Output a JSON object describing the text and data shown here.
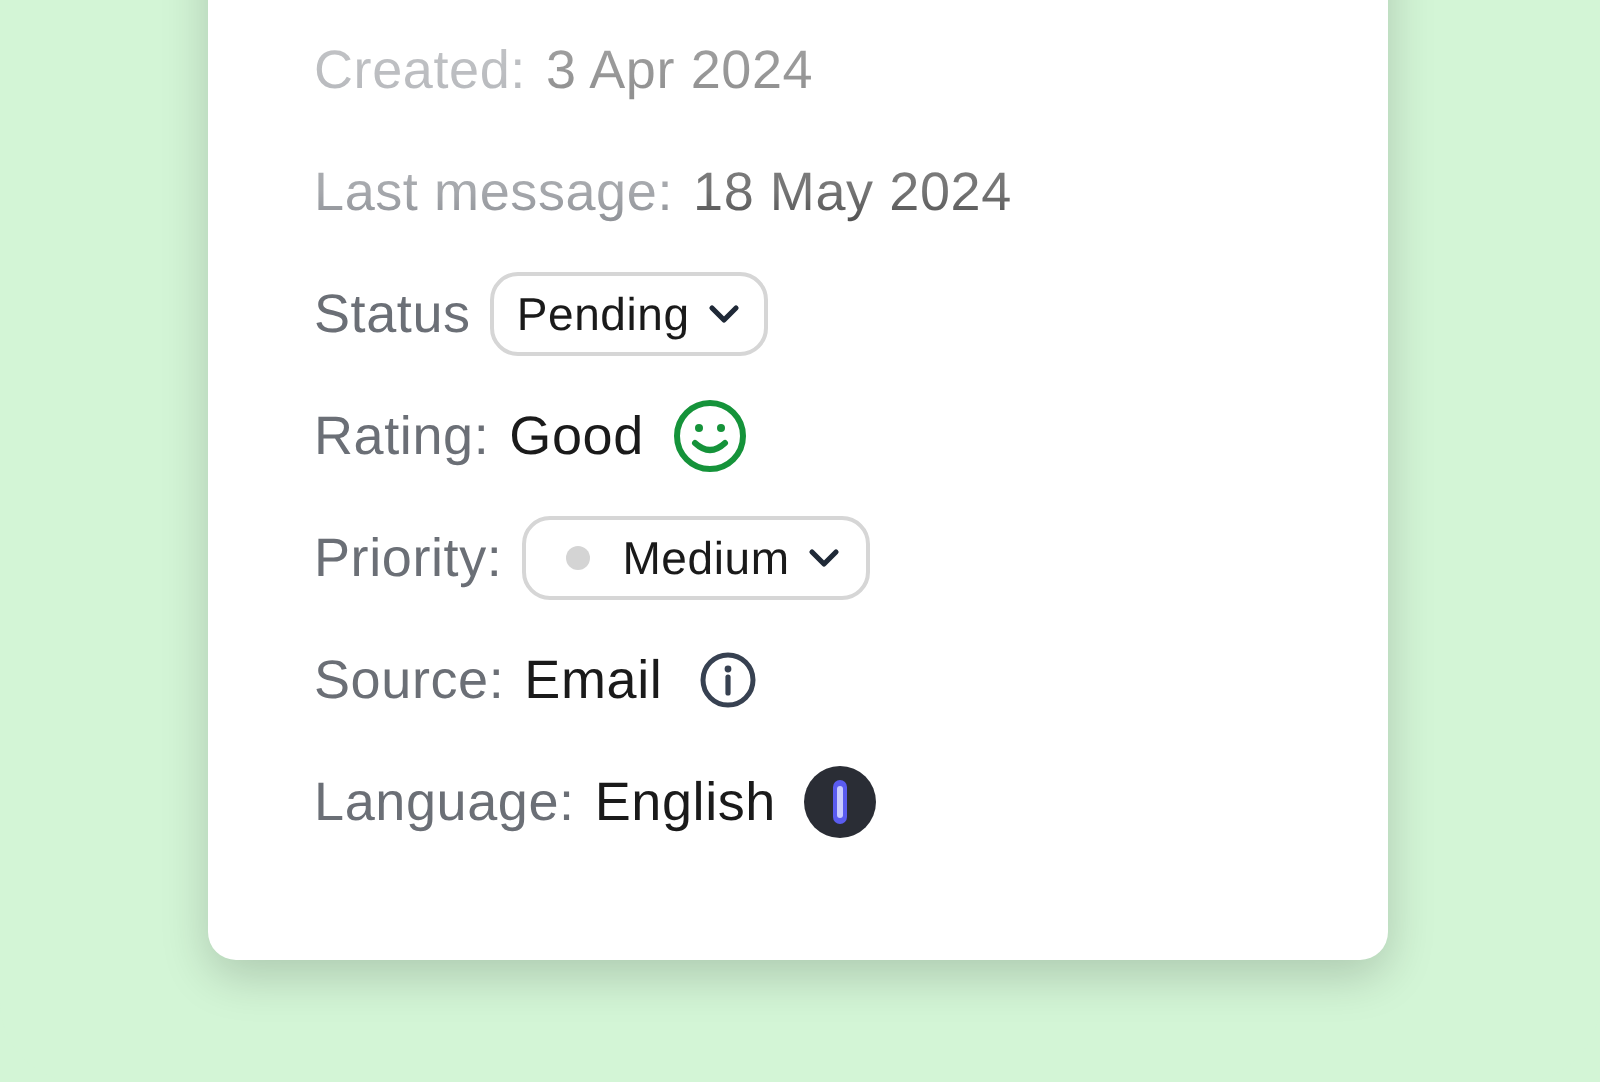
{
  "details": [
    {
      "kind": "text",
      "label": "Created:",
      "value": "3 Apr 2024"
    },
    {
      "kind": "text",
      "label": "Last message:",
      "value": "18 May 2024"
    },
    {
      "kind": "select",
      "label": "Status",
      "value": "Pending"
    },
    {
      "kind": "rating",
      "label": "Rating:",
      "value": "Good"
    },
    {
      "kind": "priority",
      "label": "Priority:",
      "value": "Medium",
      "color": "#d4d4d4"
    },
    {
      "kind": "info",
      "label": "Source:",
      "value": "Email"
    },
    {
      "kind": "language",
      "label": "Language:",
      "value": "English"
    }
  ]
}
